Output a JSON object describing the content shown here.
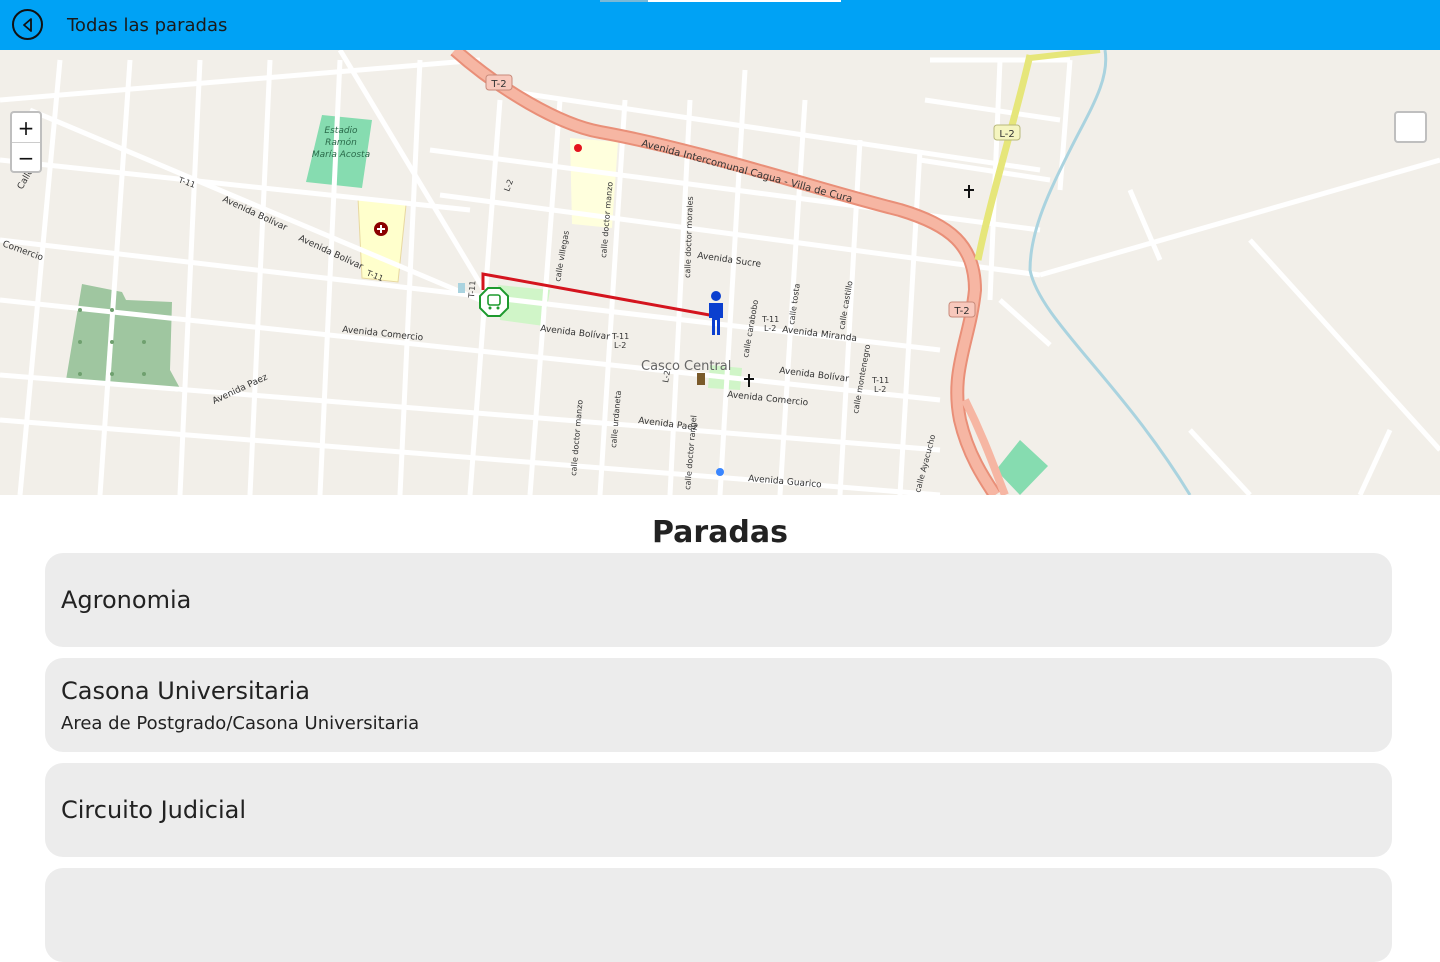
{
  "header": {
    "title": "Todas las paradas"
  },
  "map": {
    "zoom_in_label": "+",
    "zoom_out_label": "−",
    "labels": {
      "stadium": [
        "Estadio",
        "Ramón",
        "María Acosta"
      ],
      "avenida_intercomunal": "Avenida Intercomunal Cagua - Villa de Cura",
      "avenida_sucre": "Avenida Sucre",
      "avenida_bolivar_west": "Avenida Bolívar",
      "avenida_bolivar_center": "Avenida Bolívar",
      "avenida_bolivar_east": "Avenida Bolívar",
      "avenida_comercio_west": "Avenida Comercio",
      "avenida_comercio_east": "Avenida Comercio",
      "avenida_miranda": "Avenida Miranda",
      "avenida_paez_west": "Avenida Paez",
      "avenida_paez_center": "Avenida Paez",
      "avenida_guarico": "Avenida Guarico",
      "comercio_left": "Comercio",
      "calle_d": "Calle D",
      "casco_central": "Casco Central",
      "calle_villegas": "calle villegas",
      "calle_doctor_manzo": "calle doctor manzo",
      "calle_doctor_morales": "calle doctor morales",
      "calle_carabobo": "calle carabobo",
      "calle_tosta": "calle tosta",
      "calle_castillo": "calle castillo",
      "calle_montenegro": "calle montenegro",
      "calle_urdaneta": "calle urdaneta",
      "calle_doctor_rangel": "calle doctor rangel",
      "calle_ayacucho": "calle Ayacucho",
      "shield_t2": "T-2",
      "shield_l2": "L-2",
      "ref_t11": "T-11",
      "ref_l2": "L-2"
    }
  },
  "stops_section": {
    "title": "Paradas",
    "items": [
      {
        "name": "Agronomia",
        "subtitle": ""
      },
      {
        "name": "Casona Universitaria",
        "subtitle": "Area de Postgrado/Casona Universitaria"
      },
      {
        "name": "Circuito Judicial",
        "subtitle": ""
      },
      {
        "name": "",
        "subtitle": ""
      }
    ]
  },
  "colors": {
    "header_bg": "#00a2f5",
    "map_bg": "#f2efe9",
    "trunk_road": "#f1a58f",
    "route_line": "#d4141e",
    "card_bg": "#ececec",
    "park": "#86dcb0"
  }
}
